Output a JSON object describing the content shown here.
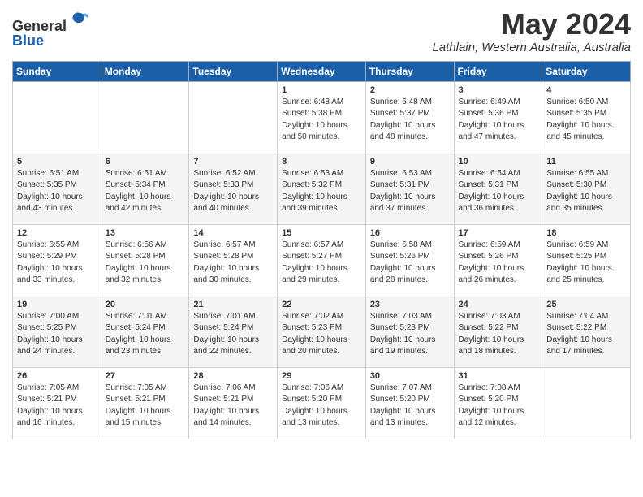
{
  "header": {
    "logo_general": "General",
    "logo_blue": "Blue",
    "month_title": "May 2024",
    "location": "Lathlain, Western Australia, Australia"
  },
  "days_of_week": [
    "Sunday",
    "Monday",
    "Tuesday",
    "Wednesday",
    "Thursday",
    "Friday",
    "Saturday"
  ],
  "weeks": [
    [
      {
        "day": "",
        "info": ""
      },
      {
        "day": "",
        "info": ""
      },
      {
        "day": "",
        "info": ""
      },
      {
        "day": "1",
        "info": "Sunrise: 6:48 AM\nSunset: 5:38 PM\nDaylight: 10 hours\nand 50 minutes."
      },
      {
        "day": "2",
        "info": "Sunrise: 6:48 AM\nSunset: 5:37 PM\nDaylight: 10 hours\nand 48 minutes."
      },
      {
        "day": "3",
        "info": "Sunrise: 6:49 AM\nSunset: 5:36 PM\nDaylight: 10 hours\nand 47 minutes."
      },
      {
        "day": "4",
        "info": "Sunrise: 6:50 AM\nSunset: 5:35 PM\nDaylight: 10 hours\nand 45 minutes."
      }
    ],
    [
      {
        "day": "5",
        "info": "Sunrise: 6:51 AM\nSunset: 5:35 PM\nDaylight: 10 hours\nand 43 minutes."
      },
      {
        "day": "6",
        "info": "Sunrise: 6:51 AM\nSunset: 5:34 PM\nDaylight: 10 hours\nand 42 minutes."
      },
      {
        "day": "7",
        "info": "Sunrise: 6:52 AM\nSunset: 5:33 PM\nDaylight: 10 hours\nand 40 minutes."
      },
      {
        "day": "8",
        "info": "Sunrise: 6:53 AM\nSunset: 5:32 PM\nDaylight: 10 hours\nand 39 minutes."
      },
      {
        "day": "9",
        "info": "Sunrise: 6:53 AM\nSunset: 5:31 PM\nDaylight: 10 hours\nand 37 minutes."
      },
      {
        "day": "10",
        "info": "Sunrise: 6:54 AM\nSunset: 5:31 PM\nDaylight: 10 hours\nand 36 minutes."
      },
      {
        "day": "11",
        "info": "Sunrise: 6:55 AM\nSunset: 5:30 PM\nDaylight: 10 hours\nand 35 minutes."
      }
    ],
    [
      {
        "day": "12",
        "info": "Sunrise: 6:55 AM\nSunset: 5:29 PM\nDaylight: 10 hours\nand 33 minutes."
      },
      {
        "day": "13",
        "info": "Sunrise: 6:56 AM\nSunset: 5:28 PM\nDaylight: 10 hours\nand 32 minutes."
      },
      {
        "day": "14",
        "info": "Sunrise: 6:57 AM\nSunset: 5:28 PM\nDaylight: 10 hours\nand 30 minutes."
      },
      {
        "day": "15",
        "info": "Sunrise: 6:57 AM\nSunset: 5:27 PM\nDaylight: 10 hours\nand 29 minutes."
      },
      {
        "day": "16",
        "info": "Sunrise: 6:58 AM\nSunset: 5:26 PM\nDaylight: 10 hours\nand 28 minutes."
      },
      {
        "day": "17",
        "info": "Sunrise: 6:59 AM\nSunset: 5:26 PM\nDaylight: 10 hours\nand 26 minutes."
      },
      {
        "day": "18",
        "info": "Sunrise: 6:59 AM\nSunset: 5:25 PM\nDaylight: 10 hours\nand 25 minutes."
      }
    ],
    [
      {
        "day": "19",
        "info": "Sunrise: 7:00 AM\nSunset: 5:25 PM\nDaylight: 10 hours\nand 24 minutes."
      },
      {
        "day": "20",
        "info": "Sunrise: 7:01 AM\nSunset: 5:24 PM\nDaylight: 10 hours\nand 23 minutes."
      },
      {
        "day": "21",
        "info": "Sunrise: 7:01 AM\nSunset: 5:24 PM\nDaylight: 10 hours\nand 22 minutes."
      },
      {
        "day": "22",
        "info": "Sunrise: 7:02 AM\nSunset: 5:23 PM\nDaylight: 10 hours\nand 20 minutes."
      },
      {
        "day": "23",
        "info": "Sunrise: 7:03 AM\nSunset: 5:23 PM\nDaylight: 10 hours\nand 19 minutes."
      },
      {
        "day": "24",
        "info": "Sunrise: 7:03 AM\nSunset: 5:22 PM\nDaylight: 10 hours\nand 18 minutes."
      },
      {
        "day": "25",
        "info": "Sunrise: 7:04 AM\nSunset: 5:22 PM\nDaylight: 10 hours\nand 17 minutes."
      }
    ],
    [
      {
        "day": "26",
        "info": "Sunrise: 7:05 AM\nSunset: 5:21 PM\nDaylight: 10 hours\nand 16 minutes."
      },
      {
        "day": "27",
        "info": "Sunrise: 7:05 AM\nSunset: 5:21 PM\nDaylight: 10 hours\nand 15 minutes."
      },
      {
        "day": "28",
        "info": "Sunrise: 7:06 AM\nSunset: 5:21 PM\nDaylight: 10 hours\nand 14 minutes."
      },
      {
        "day": "29",
        "info": "Sunrise: 7:06 AM\nSunset: 5:20 PM\nDaylight: 10 hours\nand 13 minutes."
      },
      {
        "day": "30",
        "info": "Sunrise: 7:07 AM\nSunset: 5:20 PM\nDaylight: 10 hours\nand 13 minutes."
      },
      {
        "day": "31",
        "info": "Sunrise: 7:08 AM\nSunset: 5:20 PM\nDaylight: 10 hours\nand 12 minutes."
      },
      {
        "day": "",
        "info": ""
      }
    ]
  ]
}
